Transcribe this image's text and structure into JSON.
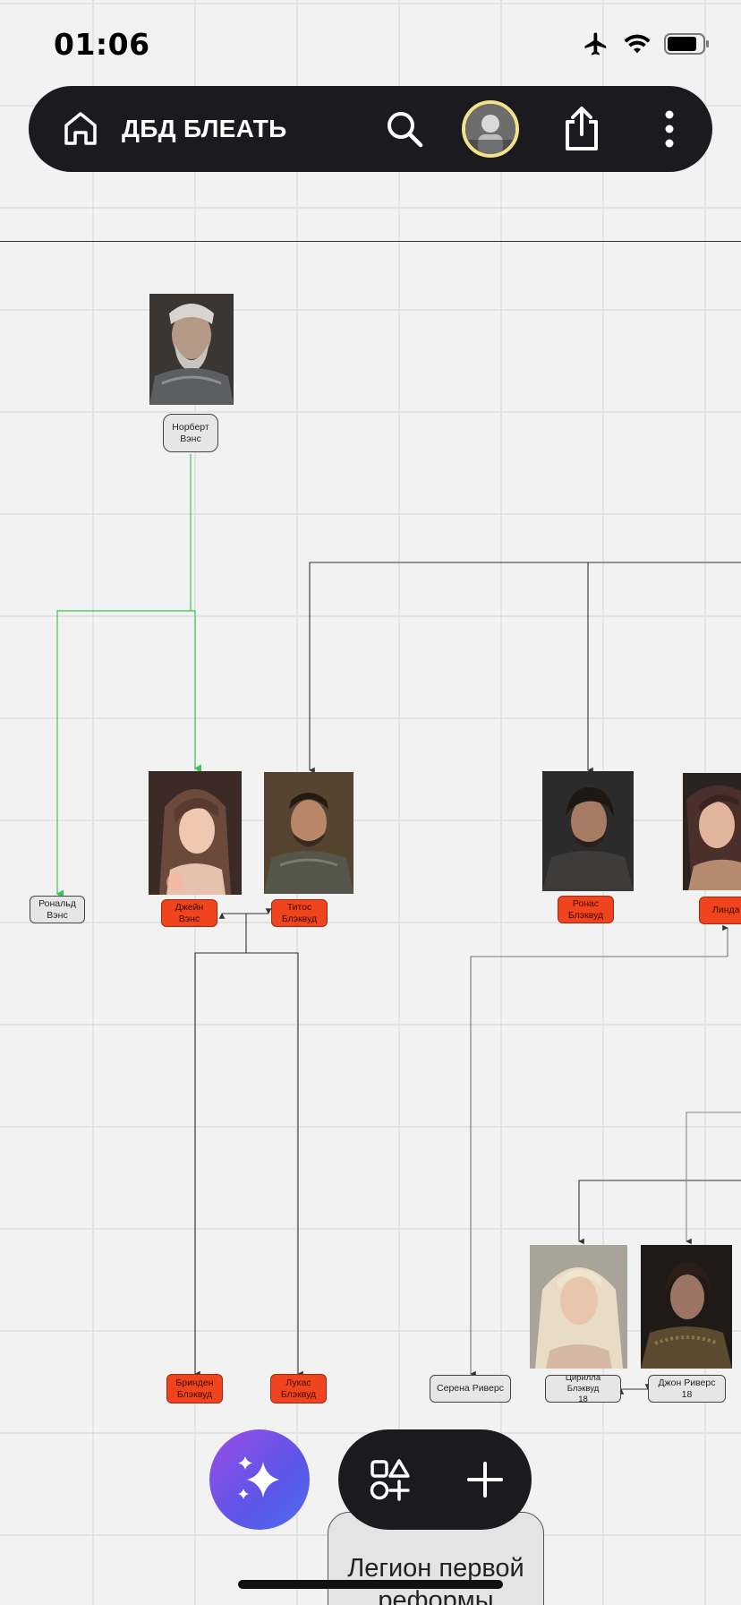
{
  "status_bar": {
    "time": "01:06"
  },
  "header": {
    "board_title": "ДБД БЛЕАТЬ"
  },
  "nodes": {
    "norbert": "Норберт\nВэнс",
    "ronald": "Рональд\nВэнс",
    "jane": "Джейн Вэнс",
    "titos": "Титос\nБлэквуд",
    "ronas": "Ронас\nБлэквуд",
    "linda": "Линда",
    "brinden": "Бринден\nБлэквуд",
    "lukas": "Лукас\nБлэквуд",
    "serena": "Серена Риверс",
    "cirilla": "Цирилла Блэквуд\n18",
    "john": "Джон Риверс\n18"
  },
  "bottom": {
    "legion_card": "Легион первой\nреформы"
  },
  "colors": {
    "toolbar_bg": "#1b1b1f",
    "canvas_bg": "#f2f2f2",
    "node_red": "#f0441f",
    "node_gray": "#e6e6e6",
    "connector_green": "#3cc35a",
    "connector_dark": "#333333",
    "ai_gradient_start": "#9b4de6",
    "ai_gradient_end": "#4f6ef0"
  },
  "icons": {
    "home": "home-icon",
    "search": "search-icon",
    "avatar": "user-avatar",
    "share": "share-icon",
    "more": "more-vertical-icon",
    "ai": "sparkles-icon",
    "shapes": "shapes-icon",
    "add": "plus-icon"
  }
}
